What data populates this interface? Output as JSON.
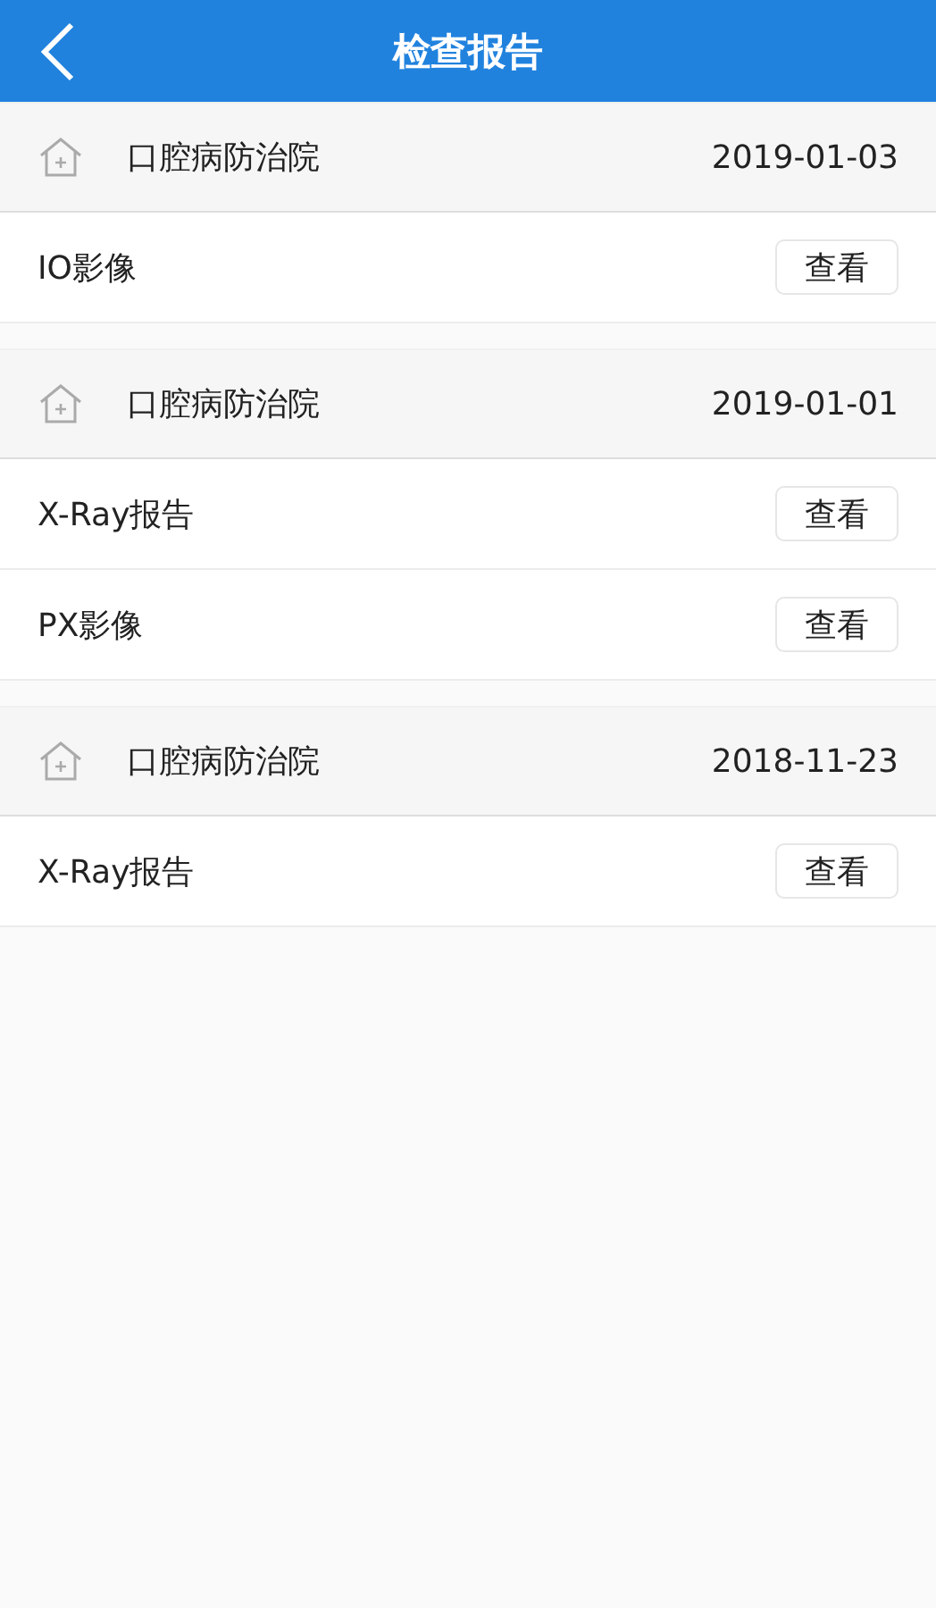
{
  "header": {
    "title": "检查报告"
  },
  "groups": [
    {
      "hospital": "口腔病防治院",
      "date": "2019-01-03",
      "reports": [
        {
          "name": "IO影像",
          "action": "查看"
        }
      ]
    },
    {
      "hospital": "口腔病防治院",
      "date": "2019-01-01",
      "reports": [
        {
          "name": "X-Ray报告",
          "action": "查看"
        },
        {
          "name": "PX影像",
          "action": "查看"
        }
      ]
    },
    {
      "hospital": "口腔病防治院",
      "date": "2018-11-23",
      "reports": [
        {
          "name": "X-Ray报告",
          "action": "查看"
        }
      ]
    }
  ]
}
